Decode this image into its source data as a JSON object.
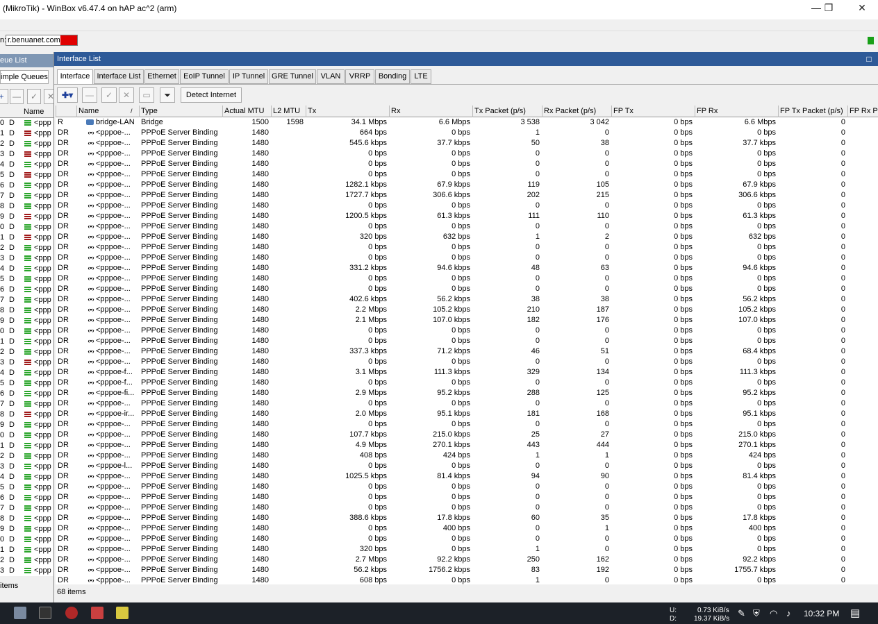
{
  "window": {
    "title": "(MikroTik) - WinBox v6.47.4 on hAP ac^2 (arm)",
    "minimize": "—",
    "maximize": "❐",
    "close": "✕"
  },
  "address": {
    "label": "n:",
    "value": "r.benuanet.com:"
  },
  "queue_window": {
    "title": "eue List",
    "tab": "imple Queues",
    "col_name": "Name",
    "row_name": "<ppp",
    "status": "items",
    "rows": [
      {
        "n": "0",
        "d": "D",
        "c": "#2aa52a"
      },
      {
        "n": "1",
        "d": "D",
        "c": "#a01818"
      },
      {
        "n": "2",
        "d": "D",
        "c": "#2aa52a"
      },
      {
        "n": "3",
        "d": "D",
        "c": "#a01818"
      },
      {
        "n": "4",
        "d": "D",
        "c": "#2aa52a"
      },
      {
        "n": "5",
        "d": "D",
        "c": "#a01818"
      },
      {
        "n": "6",
        "d": "D",
        "c": "#2aa52a"
      },
      {
        "n": "7",
        "d": "D",
        "c": "#2aa52a"
      },
      {
        "n": "8",
        "d": "D",
        "c": "#2aa52a"
      },
      {
        "n": "9",
        "d": "D",
        "c": "#a01818"
      },
      {
        "n": "0",
        "d": "D",
        "c": "#2aa52a"
      },
      {
        "n": "1",
        "d": "D",
        "c": "#a01818"
      },
      {
        "n": "2",
        "d": "D",
        "c": "#2aa52a"
      },
      {
        "n": "3",
        "d": "D",
        "c": "#2aa52a"
      },
      {
        "n": "4",
        "d": "D",
        "c": "#2aa52a"
      },
      {
        "n": "5",
        "d": "D",
        "c": "#2aa52a"
      },
      {
        "n": "6",
        "d": "D",
        "c": "#2aa52a"
      },
      {
        "n": "7",
        "d": "D",
        "c": "#2aa52a"
      },
      {
        "n": "8",
        "d": "D",
        "c": "#2aa52a"
      },
      {
        "n": "9",
        "d": "D",
        "c": "#2aa52a"
      },
      {
        "n": "0",
        "d": "D",
        "c": "#2aa52a"
      },
      {
        "n": "1",
        "d": "D",
        "c": "#2aa52a"
      },
      {
        "n": "2",
        "d": "D",
        "c": "#2aa52a"
      },
      {
        "n": "3",
        "d": "D",
        "c": "#a01818"
      },
      {
        "n": "4",
        "d": "D",
        "c": "#2aa52a"
      },
      {
        "n": "5",
        "d": "D",
        "c": "#2aa52a"
      },
      {
        "n": "6",
        "d": "D",
        "c": "#2aa52a"
      },
      {
        "n": "7",
        "d": "D",
        "c": "#2aa52a"
      },
      {
        "n": "8",
        "d": "D",
        "c": "#a01818"
      },
      {
        "n": "9",
        "d": "D",
        "c": "#2aa52a"
      },
      {
        "n": "0",
        "d": "D",
        "c": "#2aa52a"
      },
      {
        "n": "1",
        "d": "D",
        "c": "#2aa52a"
      },
      {
        "n": "2",
        "d": "D",
        "c": "#2aa52a"
      },
      {
        "n": "3",
        "d": "D",
        "c": "#2aa52a"
      },
      {
        "n": "4",
        "d": "D",
        "c": "#2aa52a"
      },
      {
        "n": "5",
        "d": "D",
        "c": "#2aa52a"
      },
      {
        "n": "6",
        "d": "D",
        "c": "#2aa52a"
      },
      {
        "n": "7",
        "d": "D",
        "c": "#2aa52a"
      },
      {
        "n": "8",
        "d": "D",
        "c": "#2aa52a"
      },
      {
        "n": "9",
        "d": "D",
        "c": "#2aa52a"
      },
      {
        "n": "0",
        "d": "D",
        "c": "#2aa52a"
      },
      {
        "n": "1",
        "d": "D",
        "c": "#2aa52a"
      },
      {
        "n": "2",
        "d": "D",
        "c": "#2aa52a"
      },
      {
        "n": "3",
        "d": "D",
        "c": "#2aa52a"
      }
    ]
  },
  "interface_window": {
    "title": "Interface List",
    "close": "□",
    "tabs": [
      "Interface",
      "Interface List",
      "Ethernet",
      "EoIP Tunnel",
      "IP Tunnel",
      "GRE Tunnel",
      "VLAN",
      "VRRP",
      "Bonding",
      "LTE"
    ],
    "toolbar": {
      "add": "✚▾",
      "remove": "—",
      "enable": "✓",
      "disable": "✕",
      "comment": "▭",
      "filter": "⏷",
      "detect": "Detect Internet"
    },
    "columns": [
      "",
      "Name",
      "Type",
      "Actual MTU",
      "L2 MTU",
      "Tx",
      "Rx",
      "Tx Packet (p/s)",
      "Rx Packet (p/s)",
      "FP Tx",
      "FP Rx",
      "FP Tx Packet (p/s)",
      "FP Rx Pa"
    ],
    "sort_mark": "/",
    "status": "68 items",
    "rows": [
      {
        "flag": "R",
        "name": "bridge-LAN",
        "type": "Bridge",
        "mtu": "1500",
        "l2": "1598",
        "tx": "34.1 Mbps",
        "rx": "6.6 Mbps",
        "txp": "3 538",
        "rxp": "3 042",
        "fptx": "0 bps",
        "fprx": "6.6 Mbps",
        "fptxp": "0"
      },
      {
        "flag": "DR",
        "name": "<pppoe-...",
        "type": "PPPoE Server Binding",
        "mtu": "1480",
        "l2": "",
        "tx": "664 bps",
        "rx": "0 bps",
        "txp": "1",
        "rxp": "0",
        "fptx": "0 bps",
        "fprx": "0 bps",
        "fptxp": "0"
      },
      {
        "flag": "DR",
        "name": "<pppoe-...",
        "type": "PPPoE Server Binding",
        "mtu": "1480",
        "l2": "",
        "tx": "545.6 kbps",
        "rx": "37.7 kbps",
        "txp": "50",
        "rxp": "38",
        "fptx": "0 bps",
        "fprx": "37.7 kbps",
        "fptxp": "0"
      },
      {
        "flag": "DR",
        "name": "<pppoe-...",
        "type": "PPPoE Server Binding",
        "mtu": "1480",
        "l2": "",
        "tx": "0 bps",
        "rx": "0 bps",
        "txp": "0",
        "rxp": "0",
        "fptx": "0 bps",
        "fprx": "0 bps",
        "fptxp": "0"
      },
      {
        "flag": "DR",
        "name": "<pppoe-...",
        "type": "PPPoE Server Binding",
        "mtu": "1480",
        "l2": "",
        "tx": "0 bps",
        "rx": "0 bps",
        "txp": "0",
        "rxp": "0",
        "fptx": "0 bps",
        "fprx": "0 bps",
        "fptxp": "0"
      },
      {
        "flag": "DR",
        "name": "<pppoe-...",
        "type": "PPPoE Server Binding",
        "mtu": "1480",
        "l2": "",
        "tx": "0 bps",
        "rx": "0 bps",
        "txp": "0",
        "rxp": "0",
        "fptx": "0 bps",
        "fprx": "0 bps",
        "fptxp": "0"
      },
      {
        "flag": "DR",
        "name": "<pppoe-...",
        "type": "PPPoE Server Binding",
        "mtu": "1480",
        "l2": "",
        "tx": "1282.1 kbps",
        "rx": "67.9 kbps",
        "txp": "119",
        "rxp": "105",
        "fptx": "0 bps",
        "fprx": "67.9 kbps",
        "fptxp": "0"
      },
      {
        "flag": "DR",
        "name": "<pppoe-...",
        "type": "PPPoE Server Binding",
        "mtu": "1480",
        "l2": "",
        "tx": "1727.7 kbps",
        "rx": "306.6 kbps",
        "txp": "202",
        "rxp": "215",
        "fptx": "0 bps",
        "fprx": "306.6 kbps",
        "fptxp": "0"
      },
      {
        "flag": "DR",
        "name": "<pppoe-...",
        "type": "PPPoE Server Binding",
        "mtu": "1480",
        "l2": "",
        "tx": "0 bps",
        "rx": "0 bps",
        "txp": "0",
        "rxp": "0",
        "fptx": "0 bps",
        "fprx": "0 bps",
        "fptxp": "0"
      },
      {
        "flag": "DR",
        "name": "<pppoe-...",
        "type": "PPPoE Server Binding",
        "mtu": "1480",
        "l2": "",
        "tx": "1200.5 kbps",
        "rx": "61.3 kbps",
        "txp": "111",
        "rxp": "110",
        "fptx": "0 bps",
        "fprx": "61.3 kbps",
        "fptxp": "0"
      },
      {
        "flag": "DR",
        "name": "<pppoe-...",
        "type": "PPPoE Server Binding",
        "mtu": "1480",
        "l2": "",
        "tx": "0 bps",
        "rx": "0 bps",
        "txp": "0",
        "rxp": "0",
        "fptx": "0 bps",
        "fprx": "0 bps",
        "fptxp": "0"
      },
      {
        "flag": "DR",
        "name": "<pppoe-...",
        "type": "PPPoE Server Binding",
        "mtu": "1480",
        "l2": "",
        "tx": "320 bps",
        "rx": "632 bps",
        "txp": "1",
        "rxp": "2",
        "fptx": "0 bps",
        "fprx": "632 bps",
        "fptxp": "0"
      },
      {
        "flag": "DR",
        "name": "<pppoe-...",
        "type": "PPPoE Server Binding",
        "mtu": "1480",
        "l2": "",
        "tx": "0 bps",
        "rx": "0 bps",
        "txp": "0",
        "rxp": "0",
        "fptx": "0 bps",
        "fprx": "0 bps",
        "fptxp": "0"
      },
      {
        "flag": "DR",
        "name": "<pppoe-...",
        "type": "PPPoE Server Binding",
        "mtu": "1480",
        "l2": "",
        "tx": "0 bps",
        "rx": "0 bps",
        "txp": "0",
        "rxp": "0",
        "fptx": "0 bps",
        "fprx": "0 bps",
        "fptxp": "0"
      },
      {
        "flag": "DR",
        "name": "<pppoe-...",
        "type": "PPPoE Server Binding",
        "mtu": "1480",
        "l2": "",
        "tx": "331.2 kbps",
        "rx": "94.6 kbps",
        "txp": "48",
        "rxp": "63",
        "fptx": "0 bps",
        "fprx": "94.6 kbps",
        "fptxp": "0"
      },
      {
        "flag": "DR",
        "name": "<pppoe-...",
        "type": "PPPoE Server Binding",
        "mtu": "1480",
        "l2": "",
        "tx": "0 bps",
        "rx": "0 bps",
        "txp": "0",
        "rxp": "0",
        "fptx": "0 bps",
        "fprx": "0 bps",
        "fptxp": "0"
      },
      {
        "flag": "DR",
        "name": "<pppoe-...",
        "type": "PPPoE Server Binding",
        "mtu": "1480",
        "l2": "",
        "tx": "0 bps",
        "rx": "0 bps",
        "txp": "0",
        "rxp": "0",
        "fptx": "0 bps",
        "fprx": "0 bps",
        "fptxp": "0"
      },
      {
        "flag": "DR",
        "name": "<pppoe-...",
        "type": "PPPoE Server Binding",
        "mtu": "1480",
        "l2": "",
        "tx": "402.6 kbps",
        "rx": "56.2 kbps",
        "txp": "38",
        "rxp": "38",
        "fptx": "0 bps",
        "fprx": "56.2 kbps",
        "fptxp": "0"
      },
      {
        "flag": "DR",
        "name": "<pppoe-...",
        "type": "PPPoE Server Binding",
        "mtu": "1480",
        "l2": "",
        "tx": "2.2 Mbps",
        "rx": "105.2 kbps",
        "txp": "210",
        "rxp": "187",
        "fptx": "0 bps",
        "fprx": "105.2 kbps",
        "fptxp": "0"
      },
      {
        "flag": "DR",
        "name": "<pppoe-...",
        "type": "PPPoE Server Binding",
        "mtu": "1480",
        "l2": "",
        "tx": "2.1 Mbps",
        "rx": "107.0 kbps",
        "txp": "182",
        "rxp": "176",
        "fptx": "0 bps",
        "fprx": "107.0 kbps",
        "fptxp": "0"
      },
      {
        "flag": "DR",
        "name": "<pppoe-...",
        "type": "PPPoE Server Binding",
        "mtu": "1480",
        "l2": "",
        "tx": "0 bps",
        "rx": "0 bps",
        "txp": "0",
        "rxp": "0",
        "fptx": "0 bps",
        "fprx": "0 bps",
        "fptxp": "0"
      },
      {
        "flag": "DR",
        "name": "<pppoe-...",
        "type": "PPPoE Server Binding",
        "mtu": "1480",
        "l2": "",
        "tx": "0 bps",
        "rx": "0 bps",
        "txp": "0",
        "rxp": "0",
        "fptx": "0 bps",
        "fprx": "0 bps",
        "fptxp": "0"
      },
      {
        "flag": "DR",
        "name": "<pppoe-...",
        "type": "PPPoE Server Binding",
        "mtu": "1480",
        "l2": "",
        "tx": "337.3 kbps",
        "rx": "71.2 kbps",
        "txp": "46",
        "rxp": "51",
        "fptx": "0 bps",
        "fprx": "68.4 kbps",
        "fptxp": "0"
      },
      {
        "flag": "DR",
        "name": "<pppoe-...",
        "type": "PPPoE Server Binding",
        "mtu": "1480",
        "l2": "",
        "tx": "0 bps",
        "rx": "0 bps",
        "txp": "0",
        "rxp": "0",
        "fptx": "0 bps",
        "fprx": "0 bps",
        "fptxp": "0"
      },
      {
        "flag": "DR",
        "name": "<pppoe-f...",
        "type": "PPPoE Server Binding",
        "mtu": "1480",
        "l2": "",
        "tx": "3.1 Mbps",
        "rx": "111.3 kbps",
        "txp": "329",
        "rxp": "134",
        "fptx": "0 bps",
        "fprx": "111.3 kbps",
        "fptxp": "0"
      },
      {
        "flag": "DR",
        "name": "<pppoe-f...",
        "type": "PPPoE Server Binding",
        "mtu": "1480",
        "l2": "",
        "tx": "0 bps",
        "rx": "0 bps",
        "txp": "0",
        "rxp": "0",
        "fptx": "0 bps",
        "fprx": "0 bps",
        "fptxp": "0"
      },
      {
        "flag": "DR",
        "name": "<pppoe-fi...",
        "type": "PPPoE Server Binding",
        "mtu": "1480",
        "l2": "",
        "tx": "2.9 Mbps",
        "rx": "95.2 kbps",
        "txp": "288",
        "rxp": "125",
        "fptx": "0 bps",
        "fprx": "95.2 kbps",
        "fptxp": "0"
      },
      {
        "flag": "DR",
        "name": "<pppoe-...",
        "type": "PPPoE Server Binding",
        "mtu": "1480",
        "l2": "",
        "tx": "0 bps",
        "rx": "0 bps",
        "txp": "0",
        "rxp": "0",
        "fptx": "0 bps",
        "fprx": "0 bps",
        "fptxp": "0"
      },
      {
        "flag": "DR",
        "name": "<pppoe-ir...",
        "type": "PPPoE Server Binding",
        "mtu": "1480",
        "l2": "",
        "tx": "2.0 Mbps",
        "rx": "95.1 kbps",
        "txp": "181",
        "rxp": "168",
        "fptx": "0 bps",
        "fprx": "95.1 kbps",
        "fptxp": "0"
      },
      {
        "flag": "DR",
        "name": "<pppoe-...",
        "type": "PPPoE Server Binding",
        "mtu": "1480",
        "l2": "",
        "tx": "0 bps",
        "rx": "0 bps",
        "txp": "0",
        "rxp": "0",
        "fptx": "0 bps",
        "fprx": "0 bps",
        "fptxp": "0"
      },
      {
        "flag": "DR",
        "name": "<pppoe-...",
        "type": "PPPoE Server Binding",
        "mtu": "1480",
        "l2": "",
        "tx": "107.7 kbps",
        "rx": "215.0 kbps",
        "txp": "25",
        "rxp": "27",
        "fptx": "0 bps",
        "fprx": "215.0 kbps",
        "fptxp": "0"
      },
      {
        "flag": "DR",
        "name": "<pppoe-...",
        "type": "PPPoE Server Binding",
        "mtu": "1480",
        "l2": "",
        "tx": "4.9 Mbps",
        "rx": "270.1 kbps",
        "txp": "443",
        "rxp": "444",
        "fptx": "0 bps",
        "fprx": "270.1 kbps",
        "fptxp": "0"
      },
      {
        "flag": "DR",
        "name": "<pppoe-...",
        "type": "PPPoE Server Binding",
        "mtu": "1480",
        "l2": "",
        "tx": "408 bps",
        "rx": "424 bps",
        "txp": "1",
        "rxp": "1",
        "fptx": "0 bps",
        "fprx": "424 bps",
        "fptxp": "0"
      },
      {
        "flag": "DR",
        "name": "<pppoe-l...",
        "type": "PPPoE Server Binding",
        "mtu": "1480",
        "l2": "",
        "tx": "0 bps",
        "rx": "0 bps",
        "txp": "0",
        "rxp": "0",
        "fptx": "0 bps",
        "fprx": "0 bps",
        "fptxp": "0"
      },
      {
        "flag": "DR",
        "name": "<pppoe-...",
        "type": "PPPoE Server Binding",
        "mtu": "1480",
        "l2": "",
        "tx": "1025.5 kbps",
        "rx": "81.4 kbps",
        "txp": "94",
        "rxp": "90",
        "fptx": "0 bps",
        "fprx": "81.4 kbps",
        "fptxp": "0"
      },
      {
        "flag": "DR",
        "name": "<pppoe-...",
        "type": "PPPoE Server Binding",
        "mtu": "1480",
        "l2": "",
        "tx": "0 bps",
        "rx": "0 bps",
        "txp": "0",
        "rxp": "0",
        "fptx": "0 bps",
        "fprx": "0 bps",
        "fptxp": "0"
      },
      {
        "flag": "DR",
        "name": "<pppoe-...",
        "type": "PPPoE Server Binding",
        "mtu": "1480",
        "l2": "",
        "tx": "0 bps",
        "rx": "0 bps",
        "txp": "0",
        "rxp": "0",
        "fptx": "0 bps",
        "fprx": "0 bps",
        "fptxp": "0"
      },
      {
        "flag": "DR",
        "name": "<pppoe-...",
        "type": "PPPoE Server Binding",
        "mtu": "1480",
        "l2": "",
        "tx": "0 bps",
        "rx": "0 bps",
        "txp": "0",
        "rxp": "0",
        "fptx": "0 bps",
        "fprx": "0 bps",
        "fptxp": "0"
      },
      {
        "flag": "DR",
        "name": "<pppoe-...",
        "type": "PPPoE Server Binding",
        "mtu": "1480",
        "l2": "",
        "tx": "388.6 kbps",
        "rx": "17.8 kbps",
        "txp": "60",
        "rxp": "35",
        "fptx": "0 bps",
        "fprx": "17.8 kbps",
        "fptxp": "0"
      },
      {
        "flag": "DR",
        "name": "<pppoe-...",
        "type": "PPPoE Server Binding",
        "mtu": "1480",
        "l2": "",
        "tx": "0 bps",
        "rx": "400 bps",
        "txp": "0",
        "rxp": "1",
        "fptx": "0 bps",
        "fprx": "400 bps",
        "fptxp": "0"
      },
      {
        "flag": "DR",
        "name": "<pppoe-...",
        "type": "PPPoE Server Binding",
        "mtu": "1480",
        "l2": "",
        "tx": "0 bps",
        "rx": "0 bps",
        "txp": "0",
        "rxp": "0",
        "fptx": "0 bps",
        "fprx": "0 bps",
        "fptxp": "0"
      },
      {
        "flag": "DR",
        "name": "<pppoe-...",
        "type": "PPPoE Server Binding",
        "mtu": "1480",
        "l2": "",
        "tx": "320 bps",
        "rx": "0 bps",
        "txp": "1",
        "rxp": "0",
        "fptx": "0 bps",
        "fprx": "0 bps",
        "fptxp": "0"
      },
      {
        "flag": "DR",
        "name": "<pppoe-...",
        "type": "PPPoE Server Binding",
        "mtu": "1480",
        "l2": "",
        "tx": "2.7 Mbps",
        "rx": "92.2 kbps",
        "txp": "250",
        "rxp": "162",
        "fptx": "0 bps",
        "fprx": "92.2 kbps",
        "fptxp": "0"
      },
      {
        "flag": "DR",
        "name": "<pppoe-...",
        "type": "PPPoE Server Binding",
        "mtu": "1480",
        "l2": "",
        "tx": "56.2 kbps",
        "rx": "1756.2 kbps",
        "txp": "83",
        "rxp": "192",
        "fptx": "0 bps",
        "fprx": "1755.7 kbps",
        "fptxp": "0"
      },
      {
        "flag": "DR",
        "name": "<pppoe-...",
        "type": "PPPoE Server Binding",
        "mtu": "1480",
        "l2": "",
        "tx": "608 bps",
        "rx": "0 bps",
        "txp": "1",
        "rxp": "0",
        "fptx": "0 bps",
        "fprx": "0 bps",
        "fptxp": "0"
      }
    ]
  },
  "taskbar": {
    "net_up_label": "U:",
    "net_down_label": "D:",
    "net_up": "0.73 KiB/s",
    "net_down": "19.37 KiB/s",
    "time": "10:32 PM",
    "icons": [
      "network-icon",
      "terminal-icon",
      "winbox-icon",
      "app-icon",
      "notes-icon"
    ]
  }
}
